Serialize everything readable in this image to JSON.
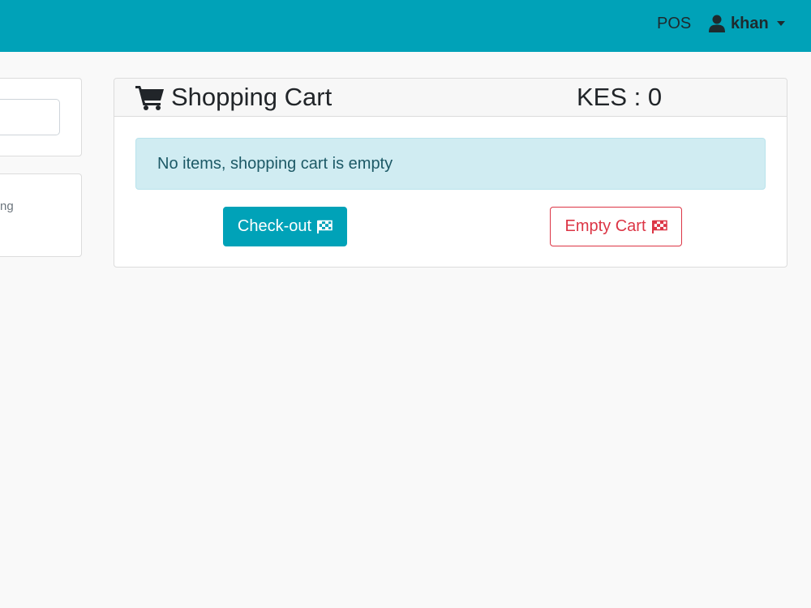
{
  "navbar": {
    "pos_label": "POS",
    "user_label": "khan",
    "background": "#00a2b8"
  },
  "left_panel": {
    "partial_text": "ng"
  },
  "cart": {
    "title": "Shopping Cart",
    "total": "KES : 0",
    "empty_message": "No items, shopping cart is empty",
    "checkout_label": "Check-out",
    "empty_cart_label": "Empty Cart",
    "icons": [
      "shopping-cart-icon",
      "checkered-flag-icon"
    ]
  },
  "colors": {
    "accent": "#00a2b8",
    "danger": "#dc3545",
    "info_bg": "#d0ecf2"
  }
}
